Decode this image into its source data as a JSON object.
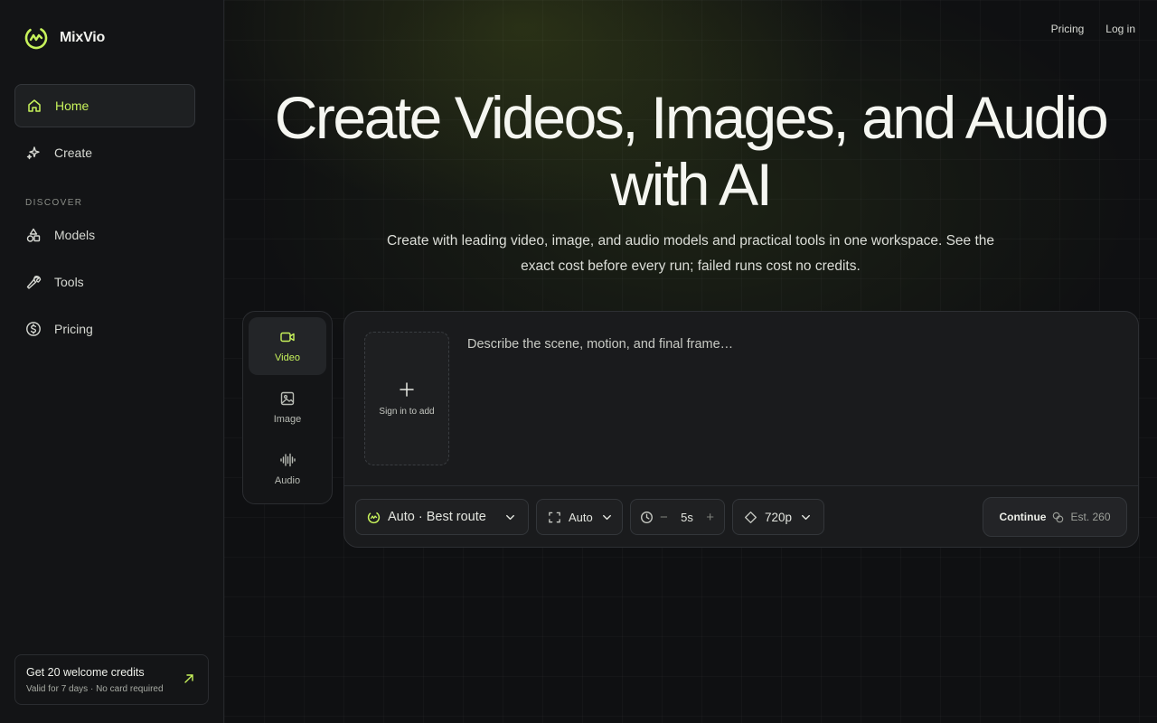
{
  "brand": {
    "name": "MixVio",
    "accent": "#c7f25b"
  },
  "sidebar": {
    "items": [
      {
        "label": "Home",
        "icon": "home-icon",
        "active": true
      },
      {
        "label": "Create",
        "icon": "sparkle-icon"
      }
    ],
    "discover_label": "DISCOVER",
    "discover_items": [
      {
        "label": "Models",
        "icon": "shapes-icon"
      },
      {
        "label": "Tools",
        "icon": "wrench-icon"
      },
      {
        "label": "Pricing",
        "icon": "dollar-icon"
      }
    ],
    "credits": {
      "title": "Get 20 welcome credits",
      "subtitle": "Valid for 7 days · No card required"
    }
  },
  "topnav": {
    "pricing": "Pricing",
    "login": "Log in"
  },
  "hero": {
    "title_line1": "Create Videos, Images, and Audio",
    "title_line2": "with AI",
    "subtitle": "Create with leading video, image, and audio models and practical tools in one workspace. See the exact cost before every run; failed runs cost no credits."
  },
  "modes": [
    {
      "label": "Video",
      "icon": "video-icon",
      "active": true
    },
    {
      "label": "Image",
      "icon": "image-icon"
    },
    {
      "label": "Audio",
      "icon": "audio-icon"
    }
  ],
  "composer": {
    "upload_label": "Sign in to add",
    "prompt_placeholder": "Describe the scene, motion, and final frame…",
    "route_label": "Auto · Best route",
    "aspect_label": "Auto",
    "duration_value": "5s",
    "resolution_label": "720p",
    "continue_label": "Continue",
    "estimate_label": "Est. 260"
  }
}
